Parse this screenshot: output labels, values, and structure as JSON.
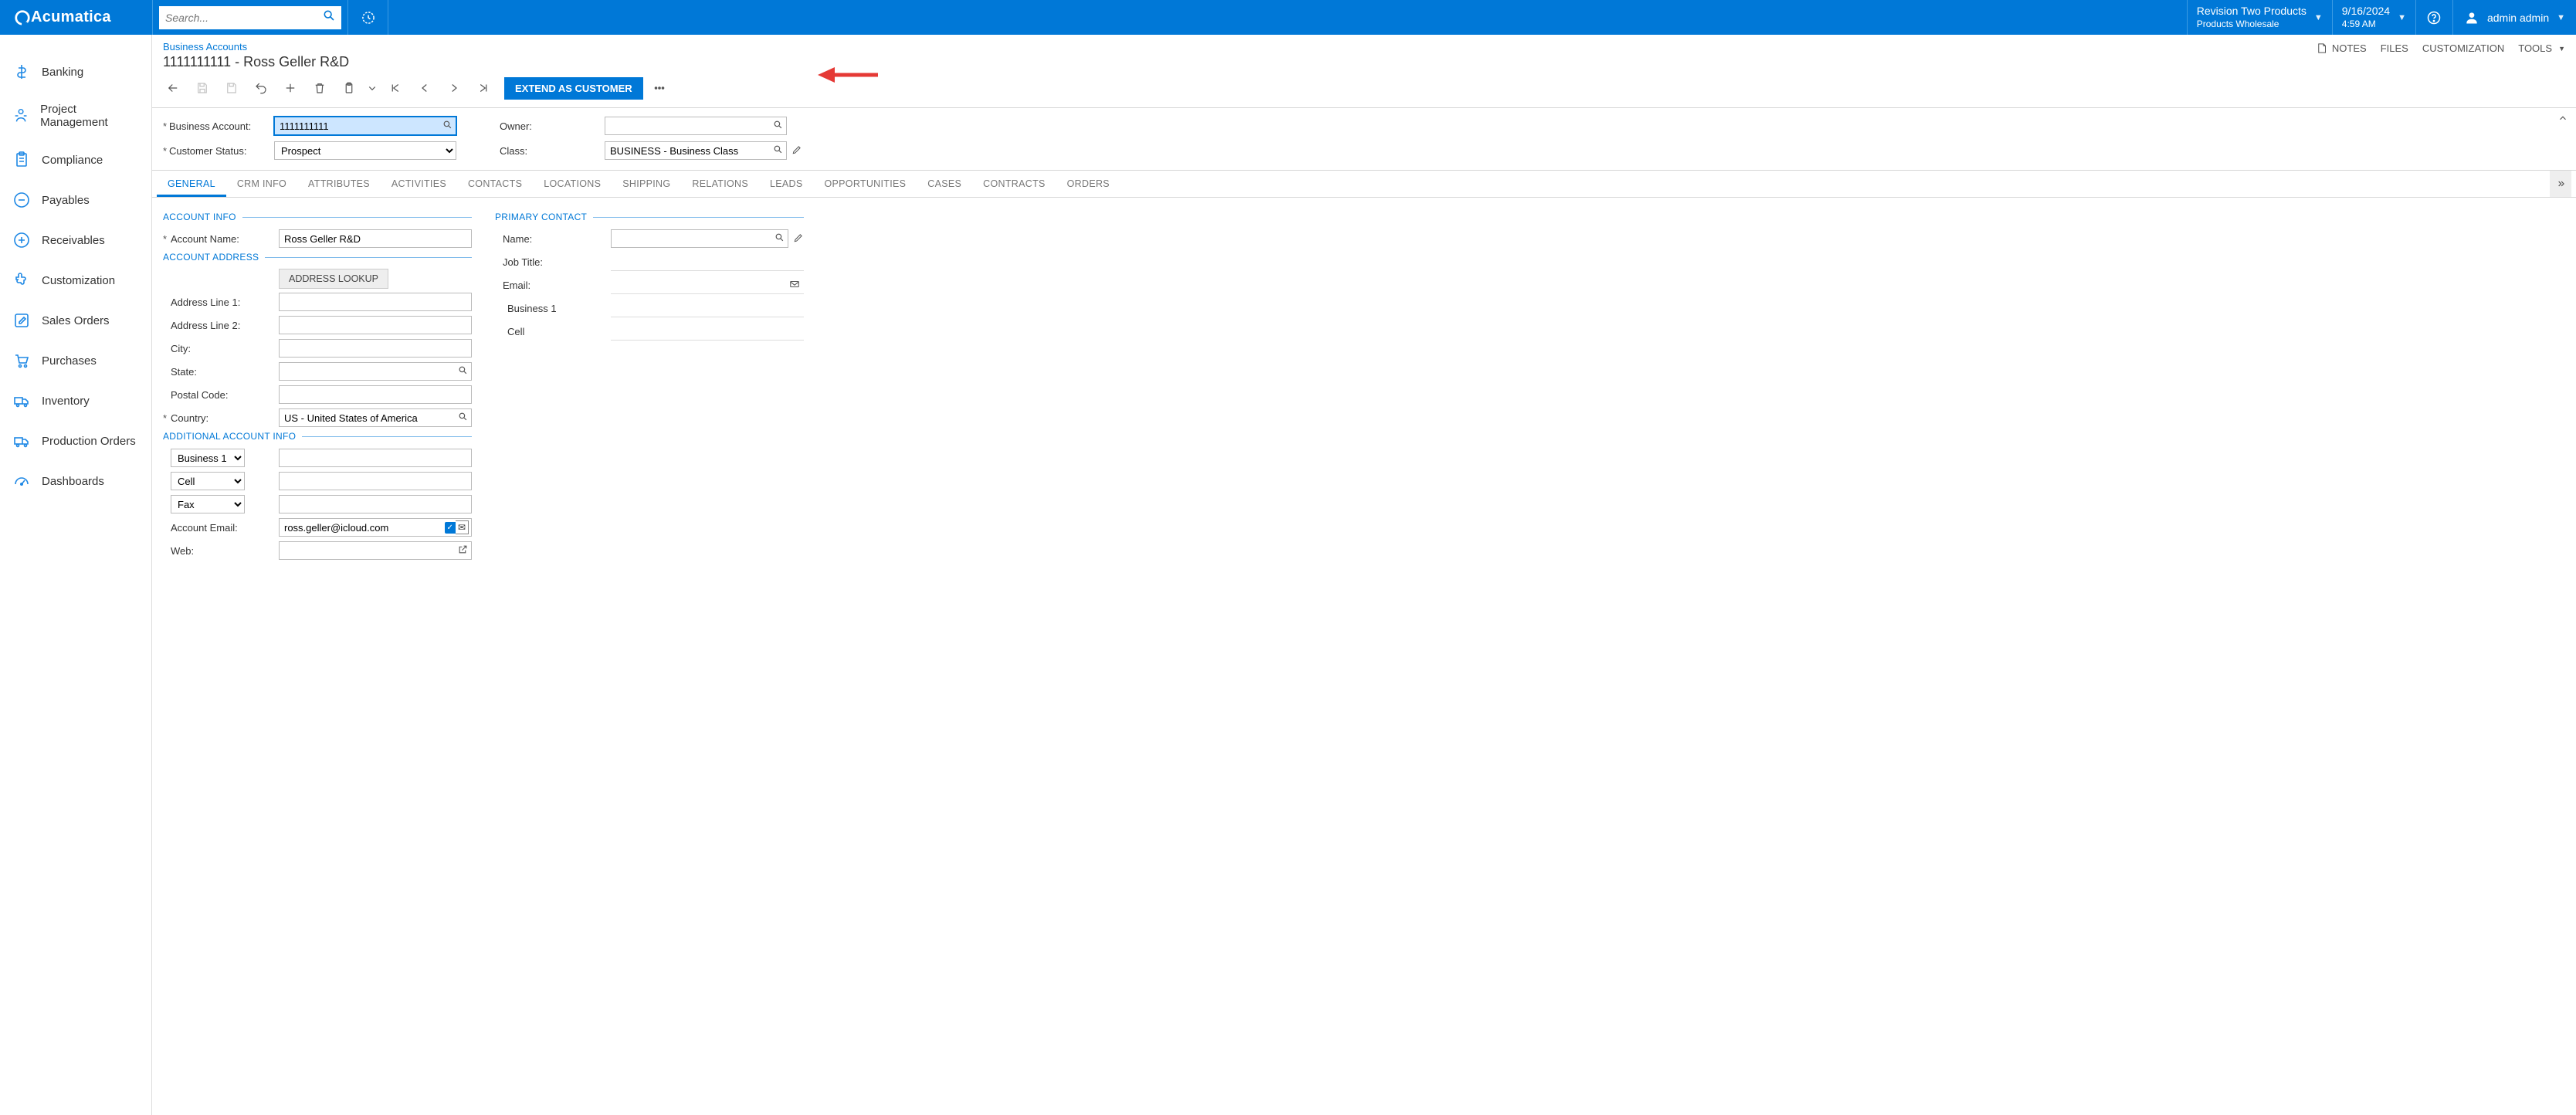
{
  "brand": "Acumatica",
  "search": {
    "placeholder": "Search..."
  },
  "header": {
    "tenant": {
      "l1": "Revision Two Products",
      "l2": "Products Wholesale"
    },
    "date": {
      "l1": "9/16/2024",
      "l2": "4:59 AM"
    },
    "user": "admin admin"
  },
  "sidebar": {
    "items": [
      {
        "label": "Banking"
      },
      {
        "label": "Project Management"
      },
      {
        "label": "Compliance"
      },
      {
        "label": "Payables"
      },
      {
        "label": "Receivables"
      },
      {
        "label": "Customization"
      },
      {
        "label": "Sales Orders"
      },
      {
        "label": "Purchases"
      },
      {
        "label": "Inventory"
      },
      {
        "label": "Production Orders"
      },
      {
        "label": "Dashboards"
      }
    ]
  },
  "crumb": "Business Accounts",
  "title": "1111111111 - Ross Geller R&D",
  "topActions": {
    "notes": "NOTES",
    "files": "FILES",
    "customization": "CUSTOMIZATION",
    "tools": "TOOLS"
  },
  "toolbar": {
    "extend": "EXTEND AS CUSTOMER"
  },
  "summary": {
    "businessAccountLabel": "Business Account:",
    "businessAccountValue": "1111111111",
    "customerStatusLabel": "Customer Status:",
    "customerStatusValue": "Prospect",
    "ownerLabel": "Owner:",
    "ownerValue": "",
    "classLabel": "Class:",
    "classValue": "BUSINESS - Business Class"
  },
  "tabs": [
    "GENERAL",
    "CRM INFO",
    "ATTRIBUTES",
    "ACTIVITIES",
    "CONTACTS",
    "LOCATIONS",
    "SHIPPING",
    "RELATIONS",
    "LEADS",
    "OPPORTUNITIES",
    "CASES",
    "CONTRACTS",
    "ORDERS"
  ],
  "general": {
    "accountInfoHdr": "ACCOUNT INFO",
    "accountNameLabel": "Account Name:",
    "accountNameValue": "Ross Geller R&D",
    "accountAddressHdr": "ACCOUNT ADDRESS",
    "addressLookup": "ADDRESS LOOKUP",
    "addr1Label": "Address Line 1:",
    "addr2Label": "Address Line 2:",
    "cityLabel": "City:",
    "stateLabel": "State:",
    "postalLabel": "Postal Code:",
    "countryLabel": "Country:",
    "countryValue": "US - United States of America",
    "additionalHdr": "ADDITIONAL ACCOUNT INFO",
    "phoneTypes": [
      "Business 1",
      "Cell",
      "Fax"
    ],
    "accountEmailLabel": "Account Email:",
    "accountEmailValue": "ross.geller@icloud.com",
    "webLabel": "Web:",
    "primaryContactHdr": "PRIMARY CONTACT",
    "pcNameLabel": "Name:",
    "pcJobLabel": "Job Title:",
    "pcEmailLabel": "Email:",
    "pcBiz1Label": "Business 1",
    "pcCellLabel": "Cell"
  }
}
